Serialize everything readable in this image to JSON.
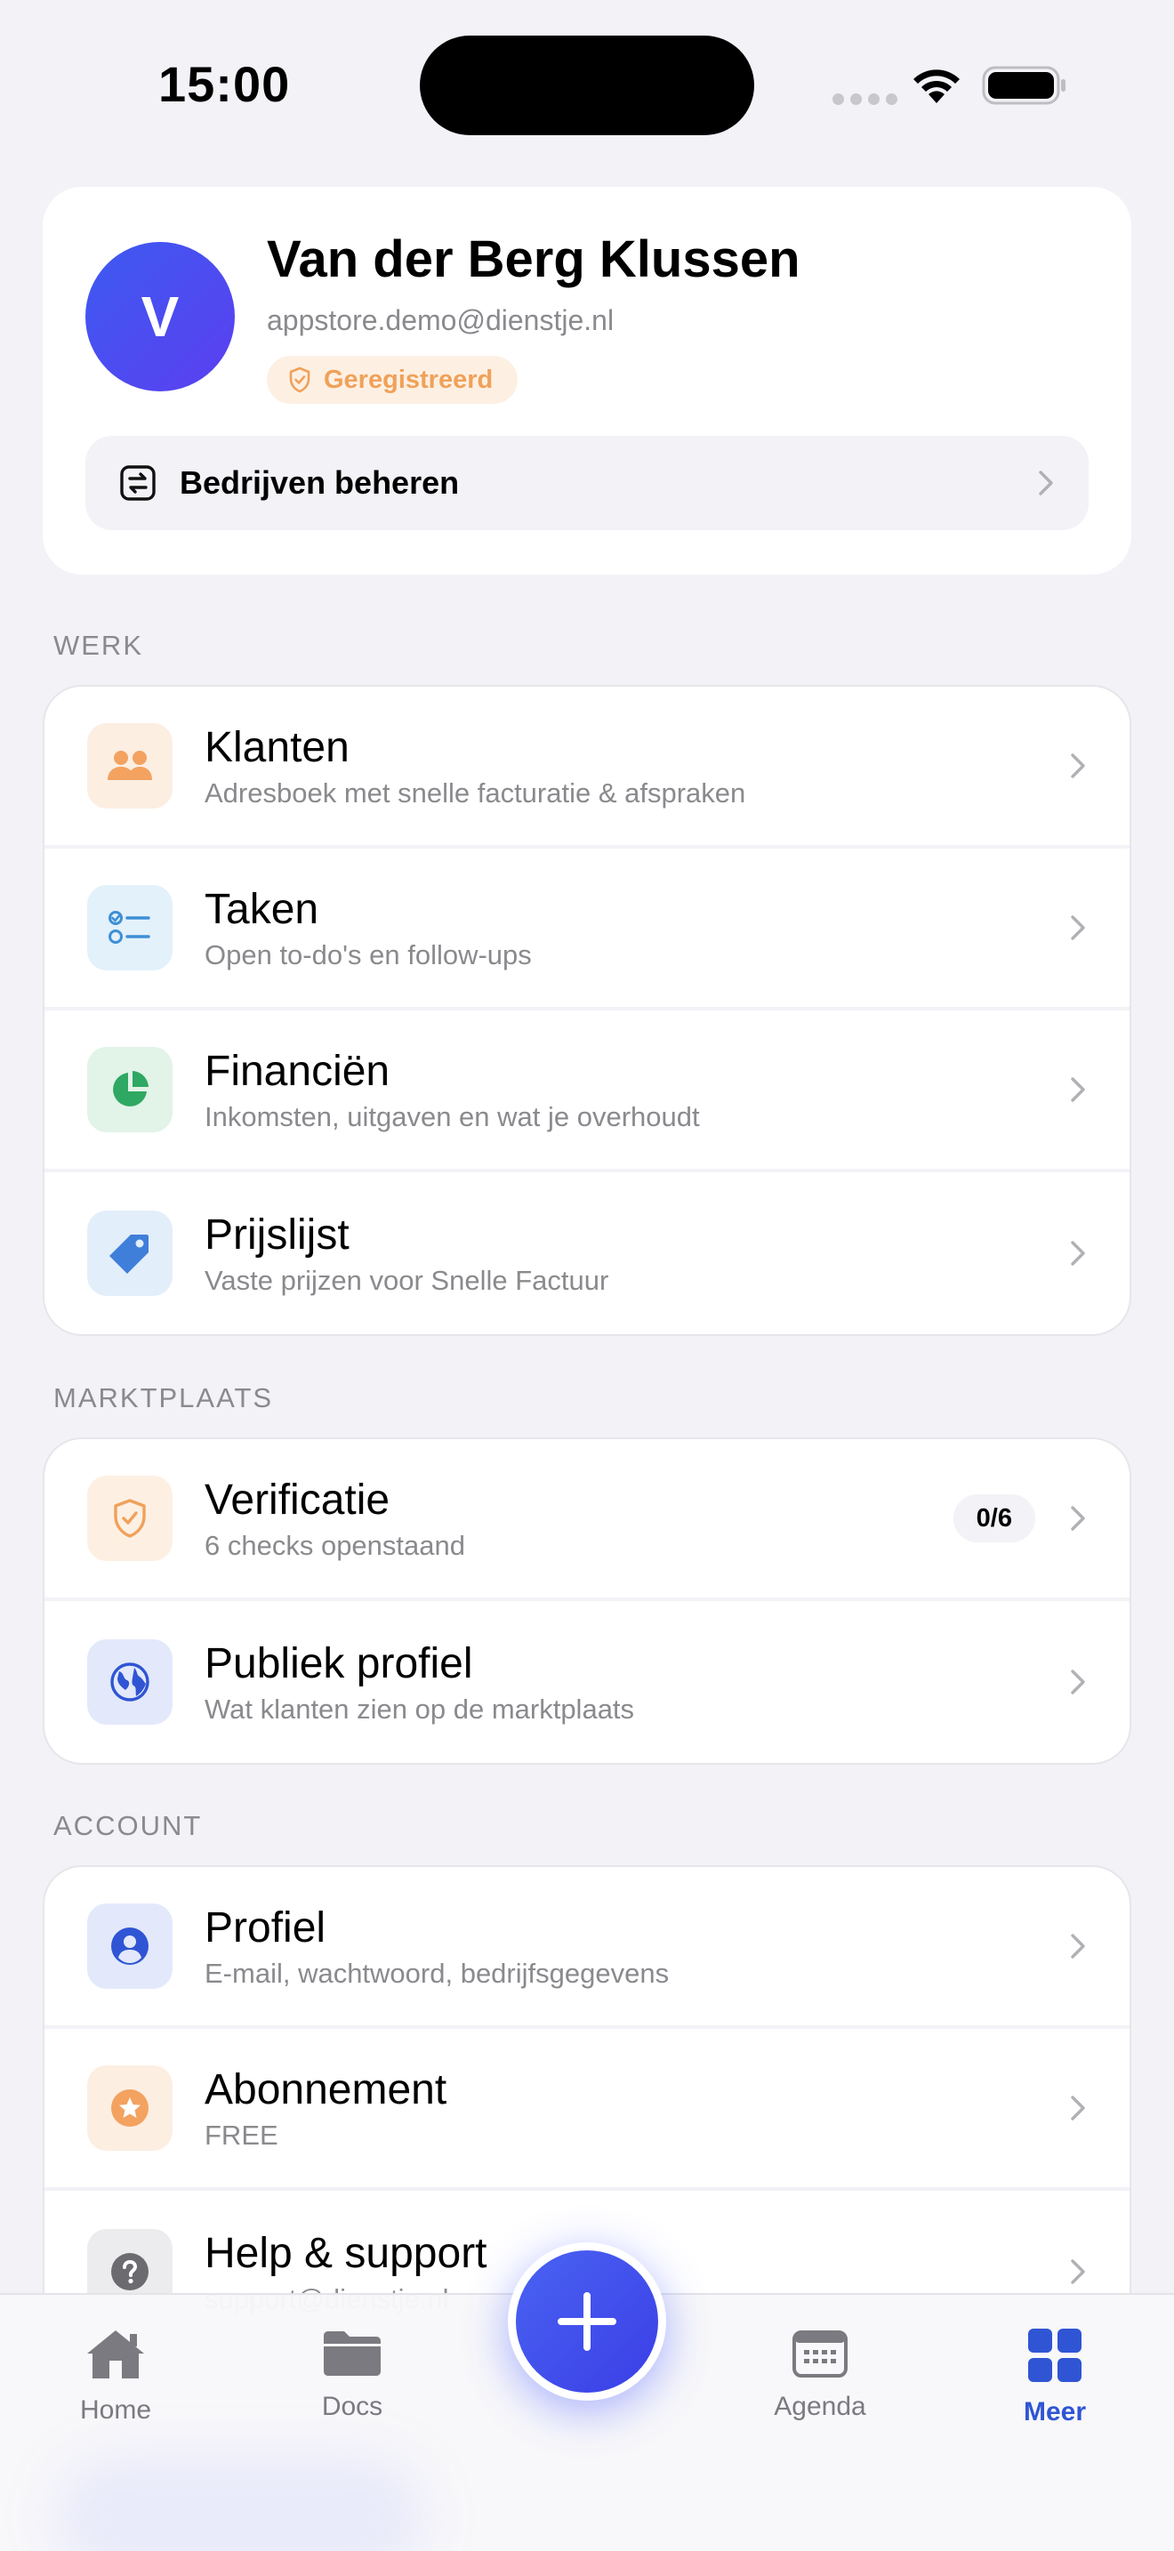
{
  "status_bar": {
    "time": "15:00"
  },
  "profile": {
    "avatar_initial": "V",
    "company_name": "Van der Berg Klussen",
    "email": "appstore.demo@dienstje.nl",
    "badge": "Geregistreerd",
    "manage_label": "Bedrijven beheren"
  },
  "sections": {
    "werk": {
      "header": "WERK",
      "items": [
        {
          "title": "Klanten",
          "subtitle": "Adresboek met snelle facturatie & afspraken"
        },
        {
          "title": "Taken",
          "subtitle": "Open to-do's en follow-ups"
        },
        {
          "title": "Financiën",
          "subtitle": "Inkomsten, uitgaven en wat je overhoudt"
        },
        {
          "title": "Prijslijst",
          "subtitle": "Vaste prijzen voor Snelle Factuur"
        }
      ]
    },
    "marktplaats": {
      "header": "MARKTPLAATS",
      "items": [
        {
          "title": "Verificatie",
          "subtitle": "6 checks openstaand",
          "badge": "0/6"
        },
        {
          "title": "Publiek profiel",
          "subtitle": "Wat klanten zien op de marktplaats"
        }
      ]
    },
    "account": {
      "header": "ACCOUNT",
      "items": [
        {
          "title": "Profiel",
          "subtitle": "E-mail, wachtwoord, bedrijfsgegevens"
        },
        {
          "title": "Abonnement",
          "subtitle": "FREE"
        },
        {
          "title": "Help & support",
          "subtitle": "support@dienstje.nl"
        }
      ]
    }
  },
  "tabs": [
    {
      "label": "Home",
      "icon": "house-icon"
    },
    {
      "label": "Docs",
      "icon": "folder-icon"
    },
    {
      "label": "Agenda",
      "icon": "calendar-icon"
    },
    {
      "label": "Meer",
      "icon": "grid-icon",
      "active": true
    }
  ],
  "colors": {
    "accent": "#2f55d4",
    "badge_orange": "#f0a15a",
    "background": "#f2f2f7"
  }
}
